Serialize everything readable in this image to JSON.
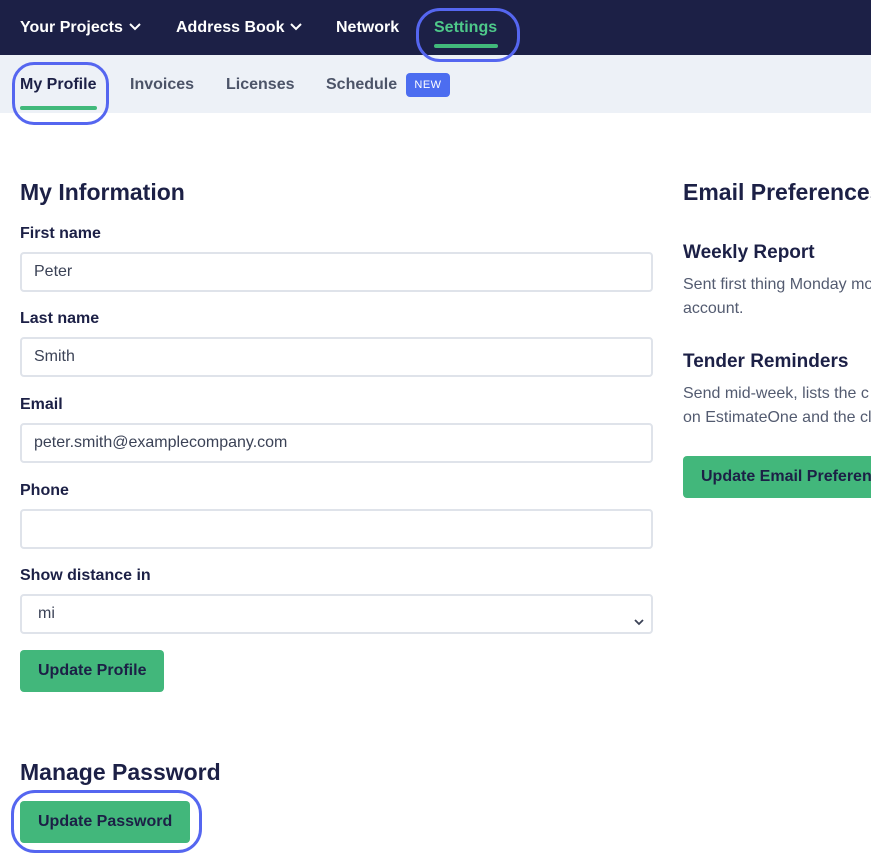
{
  "topnav": {
    "items": [
      {
        "label": "Your Projects",
        "dropdown": true
      },
      {
        "label": "Address Book",
        "dropdown": true
      },
      {
        "label": "Network",
        "dropdown": false
      },
      {
        "label": "Settings",
        "dropdown": false,
        "active": true
      }
    ]
  },
  "subnav": {
    "tabs": [
      {
        "label": "My Profile",
        "active": true
      },
      {
        "label": "Invoices"
      },
      {
        "label": "Licenses"
      },
      {
        "label": "Schedule"
      }
    ],
    "new_badge": "NEW"
  },
  "my_information": {
    "title": "My Information",
    "first_name_label": "First name",
    "first_name_value": "Peter",
    "last_name_label": "Last name",
    "last_name_value": "Smith",
    "email_label": "Email",
    "email_value": "peter.smith@examplecompany.com",
    "phone_label": "Phone",
    "phone_value": "",
    "distance_label": "Show distance in",
    "distance_value": "mi",
    "update_button": "Update Profile"
  },
  "password": {
    "title": "Manage Password",
    "update_button": "Update Password"
  },
  "email_preferences": {
    "title": "Email Preferences",
    "weekly_title": "Weekly Report",
    "weekly_desc_line1": "Sent first thing Monday mo",
    "weekly_desc_line2": "account.",
    "tender_title": "Tender Reminders",
    "tender_desc_line1": "Send mid-week, lists the c",
    "tender_desc_line2": "on EstimateOne and the cl",
    "update_button": "Update Email Preferences"
  },
  "colors": {
    "nav_bg": "#1c2046",
    "accent_green": "#42b77b",
    "badge_blue": "#4c6df0",
    "highlight_ring": "#5566f0"
  }
}
